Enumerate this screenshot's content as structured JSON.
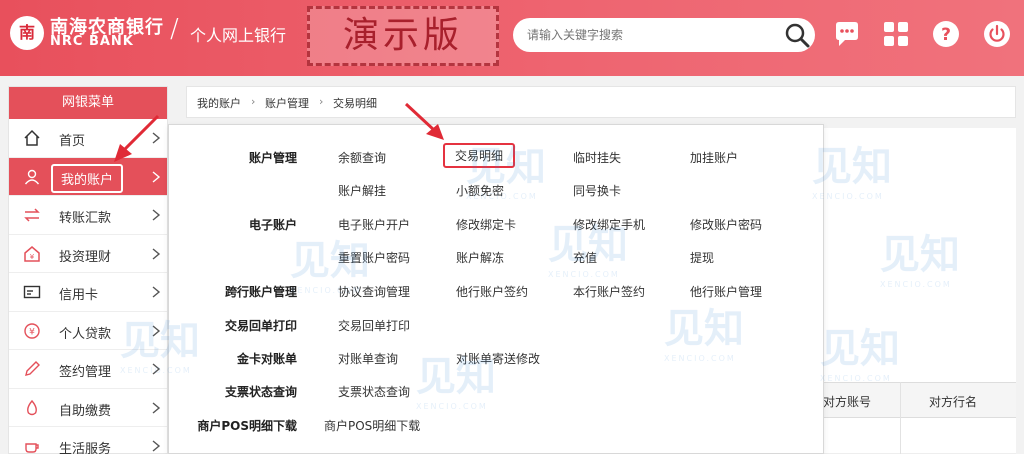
{
  "header": {
    "logo_glyph": "南",
    "bank_name": "南海农商银行",
    "bank_name_en": "NRC BANK",
    "subtitle": "个人网上银行",
    "demo_stamp": "演示版",
    "search_placeholder": "请输入关键字搜索",
    "icons": [
      "search-icon",
      "message-icon",
      "apps-icon",
      "help-icon",
      "power-icon"
    ]
  },
  "sidebar": {
    "title": "网银菜单",
    "items": [
      {
        "label": "首页",
        "icon": "home-icon"
      },
      {
        "label": "我的账户",
        "icon": "user-icon",
        "active": true
      },
      {
        "label": "转账汇款",
        "icon": "transfer-icon"
      },
      {
        "label": "投资理财",
        "icon": "invest-icon"
      },
      {
        "label": "信用卡",
        "icon": "card-icon"
      },
      {
        "label": "个人贷款",
        "icon": "loan-icon"
      },
      {
        "label": "签约管理",
        "icon": "sign-icon"
      },
      {
        "label": "自助缴费",
        "icon": "payment-icon"
      },
      {
        "label": "生活服务",
        "icon": "coffee-icon"
      }
    ]
  },
  "breadcrumb": {
    "items": [
      "我的账户",
      "账户管理",
      "交易明细"
    ]
  },
  "background_table": {
    "headers": [
      "对方账号",
      "对方行名"
    ]
  },
  "dropdown": {
    "categories": [
      "账户管理",
      "电子账户",
      "跨行账户管理",
      "交易回单打印",
      "金卡对账单",
      "支票状态查询",
      "商户POS明细下载"
    ],
    "rows": [
      [
        "余额查询",
        "交易明细",
        "临时挂失",
        "加挂账户"
      ],
      [
        "账户解挂",
        "小额免密",
        "同号换卡"
      ],
      [
        "电子账户开户",
        "修改绑定卡",
        "修改绑定手机",
        "修改账户密码"
      ],
      [
        "重置账户密码",
        "账户解冻",
        "充值",
        "提现"
      ],
      [
        "协议查询管理",
        "他行账户签约",
        "本行账户签约",
        "他行账户管理"
      ],
      [
        "交易回单打印"
      ],
      [
        "对账单查询",
        "对账单寄送修改"
      ],
      [
        "支票状态查询"
      ],
      [
        "商户POS明细下载"
      ]
    ]
  },
  "watermark": {
    "text": "见知",
    "sub": "XENCIO.COM"
  },
  "colors": {
    "primary": "#e4505a",
    "highlight_border": "#e53340",
    "watermark": "#3a8ad8"
  }
}
